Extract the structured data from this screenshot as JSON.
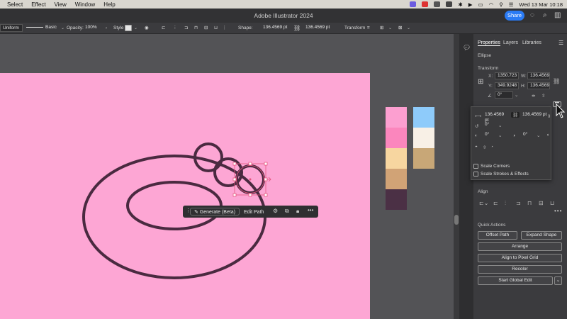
{
  "menubar": {
    "items": [
      "Select",
      "Effect",
      "View",
      "Window",
      "Help"
    ],
    "datetime": "Wed 13 Mar  10:18"
  },
  "titlebar": {
    "title": "Adobe Illustrator 2024",
    "share_label": "Share"
  },
  "control_bar": {
    "stroke_profile": "Uniform",
    "brush": "Basic",
    "opacity_label": "Opacity:",
    "opacity_value": "100%",
    "style_label": "Style",
    "shape_label": "Shape:",
    "width": "136.4569 pt",
    "height": "136.4569 pt",
    "transform_label": "Transform"
  },
  "context_bar": {
    "generate_label": "Generate (Beta)",
    "edit_path_label": "Edit Path"
  },
  "swatches": {
    "col1": [
      "#fc9fd0",
      "#fb86bd",
      "#f7d6a0",
      "#d1a376",
      "#4b3045"
    ],
    "col2": [
      "#8ecbfa",
      "#f8f0e6",
      "#c8a777"
    ]
  },
  "panel": {
    "tabs": [
      "Properties",
      "Layers",
      "Libraries"
    ],
    "object_type": "Ellipse",
    "transform_heading": "Transform",
    "x_label": "X:",
    "x_value": "1350.723",
    "y_label": "Y:",
    "y_value": "349.9248",
    "w_label": "W:",
    "w_value": "136.4569",
    "h_label": "H:",
    "h_value": "136.4569",
    "rotation_value": "0°",
    "align_heading": "Align",
    "quick_actions_heading": "Quick Actions",
    "offset_path_label": "Offset Path",
    "expand_shape_label": "Expand Shape",
    "arrange_label": "Arrange",
    "align_pixel_label": "Align to Pixel Grid",
    "recolor_label": "Recolor",
    "global_edit_label": "Start Global Edit"
  },
  "popup": {
    "width": "136.4569 pt",
    "height": "136.4569 pt",
    "angle1": "0°",
    "angle2": "0°",
    "angle3": "0°",
    "scale_corners_label": "Scale Corners",
    "scale_strokes_label": "Scale Strokes & Effects"
  },
  "colors": {
    "artboard": "#fda6d4",
    "stroke": "#4a2a40",
    "accent": "#2a7bf4"
  }
}
